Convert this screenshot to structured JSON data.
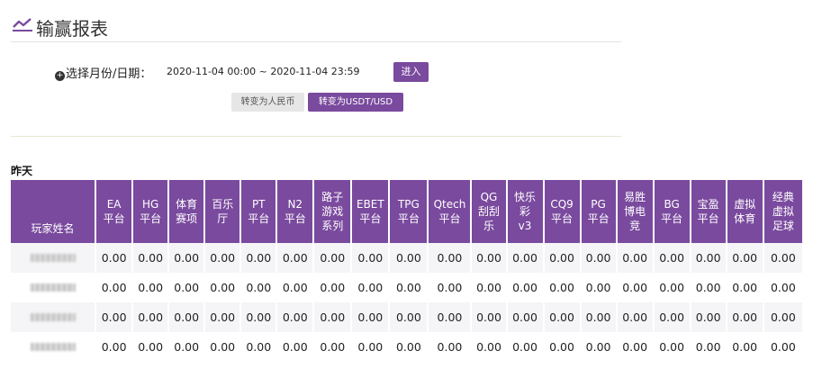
{
  "page": {
    "title": "输赢报表",
    "title_icon": "trend-chart-icon",
    "accent_color": "#7a4a9e"
  },
  "filter": {
    "label": "选择月份/日期：",
    "label_icon": "plus-circle-icon",
    "date_range": "2020-11-04 00:00 ~ 2020-11-04 23:59",
    "enter_label": "进入"
  },
  "currency": {
    "rmb_label": "转变为人民币",
    "usdt_label": "转变为USDT/USD",
    "active": "usdt"
  },
  "section": {
    "title": "昨天"
  },
  "table": {
    "name_header": "玩家姓名",
    "columns": [
      "EA平台",
      "HG平台",
      "体育赛项",
      "百乐厅",
      "PT平台",
      "N2平台",
      "路子游戏系列",
      "EBET平台",
      "TPG平台",
      "Qtech平台",
      "QG刮刮乐",
      "快乐彩v3",
      "CQ9平台",
      "PG平台",
      "易胜博电竞",
      "BG平台",
      "宝盈平台",
      "虚拟体育",
      "经典虚拟足球"
    ],
    "header_lines": [
      [
        "EA",
        "平台"
      ],
      [
        "HG",
        "平台"
      ],
      [
        "体育",
        "赛项"
      ],
      [
        "百乐",
        "厅"
      ],
      [
        "PT",
        "平台"
      ],
      [
        "N2",
        "平台"
      ],
      [
        "路子",
        "游戏",
        "系列"
      ],
      [
        "EBET",
        "平台"
      ],
      [
        "TPG",
        "平台"
      ],
      [
        "Qtech",
        "平台"
      ],
      [
        "QG",
        "刮刮",
        "乐"
      ],
      [
        "快乐",
        "彩",
        "v3"
      ],
      [
        "CQ9",
        "平台"
      ],
      [
        "PG",
        "平台"
      ],
      [
        "易胜",
        "博电",
        "竞"
      ],
      [
        "BG",
        "平台"
      ],
      [
        "宝盈",
        "平台"
      ],
      [
        "虚拟",
        "体育"
      ],
      [
        "经典",
        "虚拟",
        "足球"
      ]
    ],
    "rows": [
      {
        "name": "",
        "values": [
          "0.00",
          "0.00",
          "0.00",
          "0.00",
          "0.00",
          "0.00",
          "0.00",
          "0.00",
          "0.00",
          "0.00",
          "0.00",
          "0.00",
          "0.00",
          "0.00",
          "0.00",
          "0.00",
          "0.00",
          "0.00",
          "0.00"
        ]
      },
      {
        "name": "",
        "values": [
          "0.00",
          "0.00",
          "0.00",
          "0.00",
          "0.00",
          "0.00",
          "0.00",
          "0.00",
          "0.00",
          "0.00",
          "0.00",
          "0.00",
          "0.00",
          "0.00",
          "0.00",
          "0.00",
          "0.00",
          "0.00",
          "0.00"
        ]
      },
      {
        "name": "",
        "values": [
          "0.00",
          "0.00",
          "0.00",
          "0.00",
          "0.00",
          "0.00",
          "0.00",
          "0.00",
          "0.00",
          "0.00",
          "0.00",
          "0.00",
          "0.00",
          "0.00",
          "0.00",
          "0.00",
          "0.00",
          "0.00",
          "0.00"
        ]
      },
      {
        "name": "",
        "values": [
          "0.00",
          "0.00",
          "0.00",
          "0.00",
          "0.00",
          "0.00",
          "0.00",
          "0.00",
          "0.00",
          "0.00",
          "0.00",
          "0.00",
          "0.00",
          "0.00",
          "0.00",
          "0.00",
          "0.00",
          "0.00",
          "0.00"
        ]
      }
    ]
  }
}
